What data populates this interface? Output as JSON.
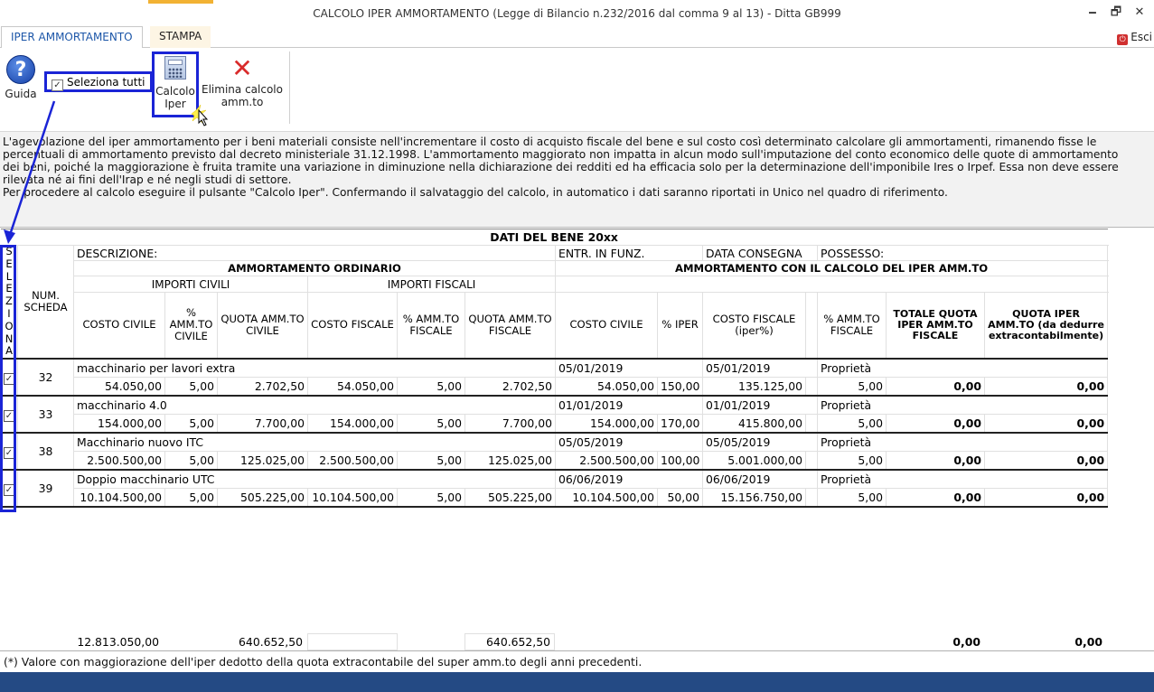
{
  "window": {
    "title": "CALCOLO IPER AMMORTAMENTO (Legge di Bilancio n.232/2016 dal comma 9 al 13) - Ditta GB999",
    "minimize": "🗕",
    "maximize": "🗗",
    "close": "✕"
  },
  "tabs": {
    "iper": "IPER AMMORTAMENTO",
    "stampa": "STAMPA",
    "esci": "Esci"
  },
  "ribbon": {
    "guida": "Guida",
    "seleziona_tutti": "Seleziona tutti",
    "calcolo_l1": "Calcolo",
    "calcolo_l2": "Iper",
    "elimina_l1": "Elimina calcolo",
    "elimina_l2": "amm.to",
    "icons": {
      "guida": "help-question-icon",
      "calcolo": "calculator-icon",
      "elimina": "red-x-delete-icon"
    }
  },
  "info_text": "L'agevolazione del iper ammortamento per i beni materiali consiste nell'incrementare il costo di acquisto fiscale del bene e sul costo così determinato calcolare gli ammortamenti, rimanendo fisse le\npercentuali di ammortamento previsto dal decreto ministeriale 31.12.1998. L'ammortamento maggiorato non impatta in alcun modo sull'imputazione del conto economico delle quote di ammortamento\ndei beni, poiché la maggiorazione è fruita tramite una variazione in diminuzione nella dichiarazione dei redditi ed ha efficacia solo per la determinazione dell'imponibile Ires o Irpef. Essa non deve essere\nrilevata né ai fini dell'Irap e né negli studi di settore.\nPer procedere al calcolo eseguire il pulsante \"Calcolo Iper\". Confermando il salvataggio del calcolo, in automatico i dati saranno riportati in Unico nel quadro di riferimento.",
  "grid": {
    "section_title": "DATI DEL BENE 20xx",
    "seleziona_letters": [
      "S",
      "E",
      "L",
      "E",
      "Z",
      "I",
      "O",
      "N",
      "A"
    ],
    "num_scheda": "NUM. SCHEDA",
    "descrizione": "DESCRIZIONE:",
    "entr_in_funz": "ENTR. IN FUNZ.",
    "data_consegna": "DATA CONSEGNA",
    "possesso": "POSSESSO:",
    "amm_ordinario": "AMMORTAMENTO ORDINARIO",
    "amm_iper": "AMMORTAMENTO CON IL CALCOLO DEL IPER AMM.TO",
    "importi_civili": "IMPORTI CIVILI",
    "importi_fiscali": "IMPORTI FISCALI",
    "cols": {
      "costo_civile": "COSTO CIVILE",
      "perc_civile": "% AMM.TO CIVILE",
      "quota_civile": "QUOTA AMM.TO CIVILE",
      "costo_fiscale": "COSTO FISCALE",
      "perc_fiscale": "% AMM.TO FISCALE",
      "quota_fiscale": "QUOTA AMM.TO FISCALE",
      "iper_costo_civile": "COSTO CIVILE",
      "perc_iper": "% IPER",
      "costo_fiscale_iper": "COSTO FISCALE (iper%)",
      "iper_perc_fiscale": "% AMM.TO FISCALE",
      "totale_quota": "TOTALE QUOTA IPER AMM.TO FISCALE",
      "quota_iper": "QUOTA IPER AMM.TO (da dedurre extracontabilmente)"
    },
    "rows": [
      {
        "checked": "✓",
        "num": "32",
        "desc": "macchinario per lavori extra",
        "entr": "05/01/2019",
        "consegna": "05/01/2019",
        "possesso": "Proprietà",
        "costo_civile": "54.050,00",
        "perc_civile": "5,00",
        "quota_civile": "2.702,50",
        "costo_fiscale": "54.050,00",
        "perc_fiscale": "5,00",
        "quota_fiscale": "2.702,50",
        "iper_costo_civile": "54.050,00",
        "perc_iper": "150,00",
        "costo_fiscale_iper": "135.125,00",
        "iper_perc_fiscale": "5,00",
        "totale_quota": "0,00",
        "quota_iper": "0,00"
      },
      {
        "checked": "✓",
        "num": "33",
        "desc": "macchinario 4.0",
        "entr": "01/01/2019",
        "consegna": "01/01/2019",
        "possesso": "Proprietà",
        "costo_civile": "154.000,00",
        "perc_civile": "5,00",
        "quota_civile": "7.700,00",
        "costo_fiscale": "154.000,00",
        "perc_fiscale": "5,00",
        "quota_fiscale": "7.700,00",
        "iper_costo_civile": "154.000,00",
        "perc_iper": "170,00",
        "costo_fiscale_iper": "415.800,00",
        "iper_perc_fiscale": "5,00",
        "totale_quota": "0,00",
        "quota_iper": "0,00"
      },
      {
        "checked": "✓",
        "num": "38",
        "desc": "Macchinario nuovo ITC",
        "entr": "05/05/2019",
        "consegna": "05/05/2019",
        "possesso": "Proprietà",
        "costo_civile": "2.500.500,00",
        "perc_civile": "5,00",
        "quota_civile": "125.025,00",
        "costo_fiscale": "2.500.500,00",
        "perc_fiscale": "5,00",
        "quota_fiscale": "125.025,00",
        "iper_costo_civile": "2.500.500,00",
        "perc_iper": "100,00",
        "costo_fiscale_iper": "5.001.000,00",
        "iper_perc_fiscale": "5,00",
        "totale_quota": "0,00",
        "quota_iper": "0,00"
      },
      {
        "checked": "✓",
        "num": "39",
        "desc": "Doppio macchinario UTC",
        "entr": "06/06/2019",
        "consegna": "06/06/2019",
        "possesso": "Proprietà",
        "costo_civile": "10.104.500,00",
        "perc_civile": "5,00",
        "quota_civile": "505.225,00",
        "costo_fiscale": "10.104.500,00",
        "perc_fiscale": "5,00",
        "quota_fiscale": "505.225,00",
        "iper_costo_civile": "10.104.500,00",
        "perc_iper": "50,00",
        "costo_fiscale_iper": "15.156.750,00",
        "iper_perc_fiscale": "5,00",
        "totale_quota": "0,00",
        "quota_iper": "0,00"
      }
    ]
  },
  "totals": {
    "costo_civile": "12.813.050,00",
    "quota_civile": "640.652,50",
    "quota_fiscale": "640.652,50",
    "totale_quota": "0,00",
    "quota_iper": "0,00"
  },
  "footnote": "(*) Valore con maggiorazione dell'iper dedotto della quota extracontabile del super amm.to degli anni precedenti.",
  "colors": {
    "highlight": "#1a24d6",
    "status_bar": "#244a84",
    "tab_active": "#1c56a8",
    "stampa_accent": "#f2b233"
  }
}
